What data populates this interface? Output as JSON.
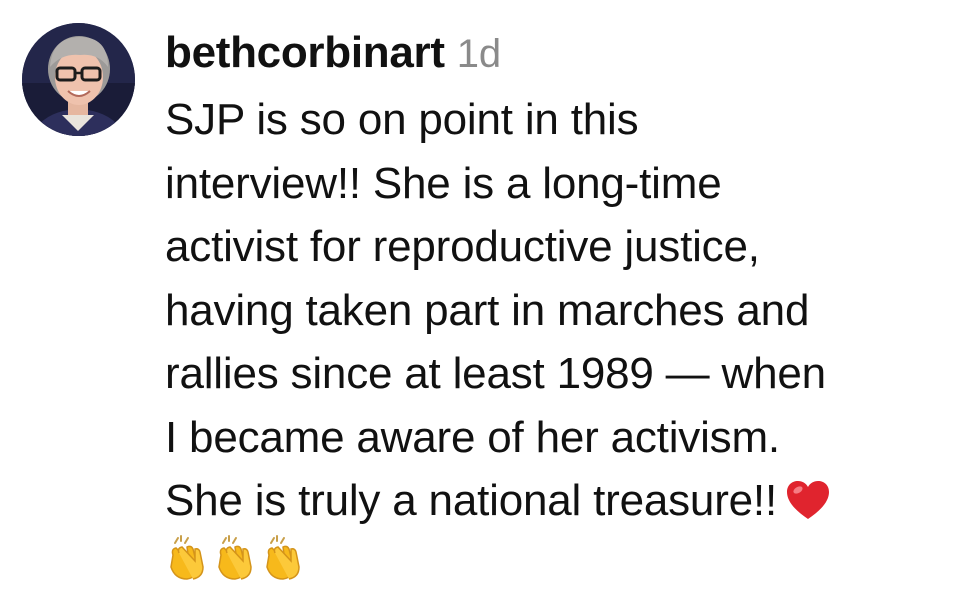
{
  "comment": {
    "username": "bethcorbinart",
    "timestamp": "1d",
    "lines": [
      "SJP is so on point in this",
      "interview!! She is a long-time",
      "activist for reproductive justice,",
      "having taken part in marches and",
      "rallies since at least 1989 — when",
      "I became aware of her activism.",
      "She is truly a national treasure!!"
    ],
    "icons": {
      "avatar": "user-avatar",
      "heart": "red-heart-emoji",
      "clap": "clapping-hands-emoji"
    },
    "colors": {
      "username": "#111111",
      "timestamp": "#8a8a8a",
      "heart": "#e0242e",
      "clap": "#f7b91b"
    }
  }
}
